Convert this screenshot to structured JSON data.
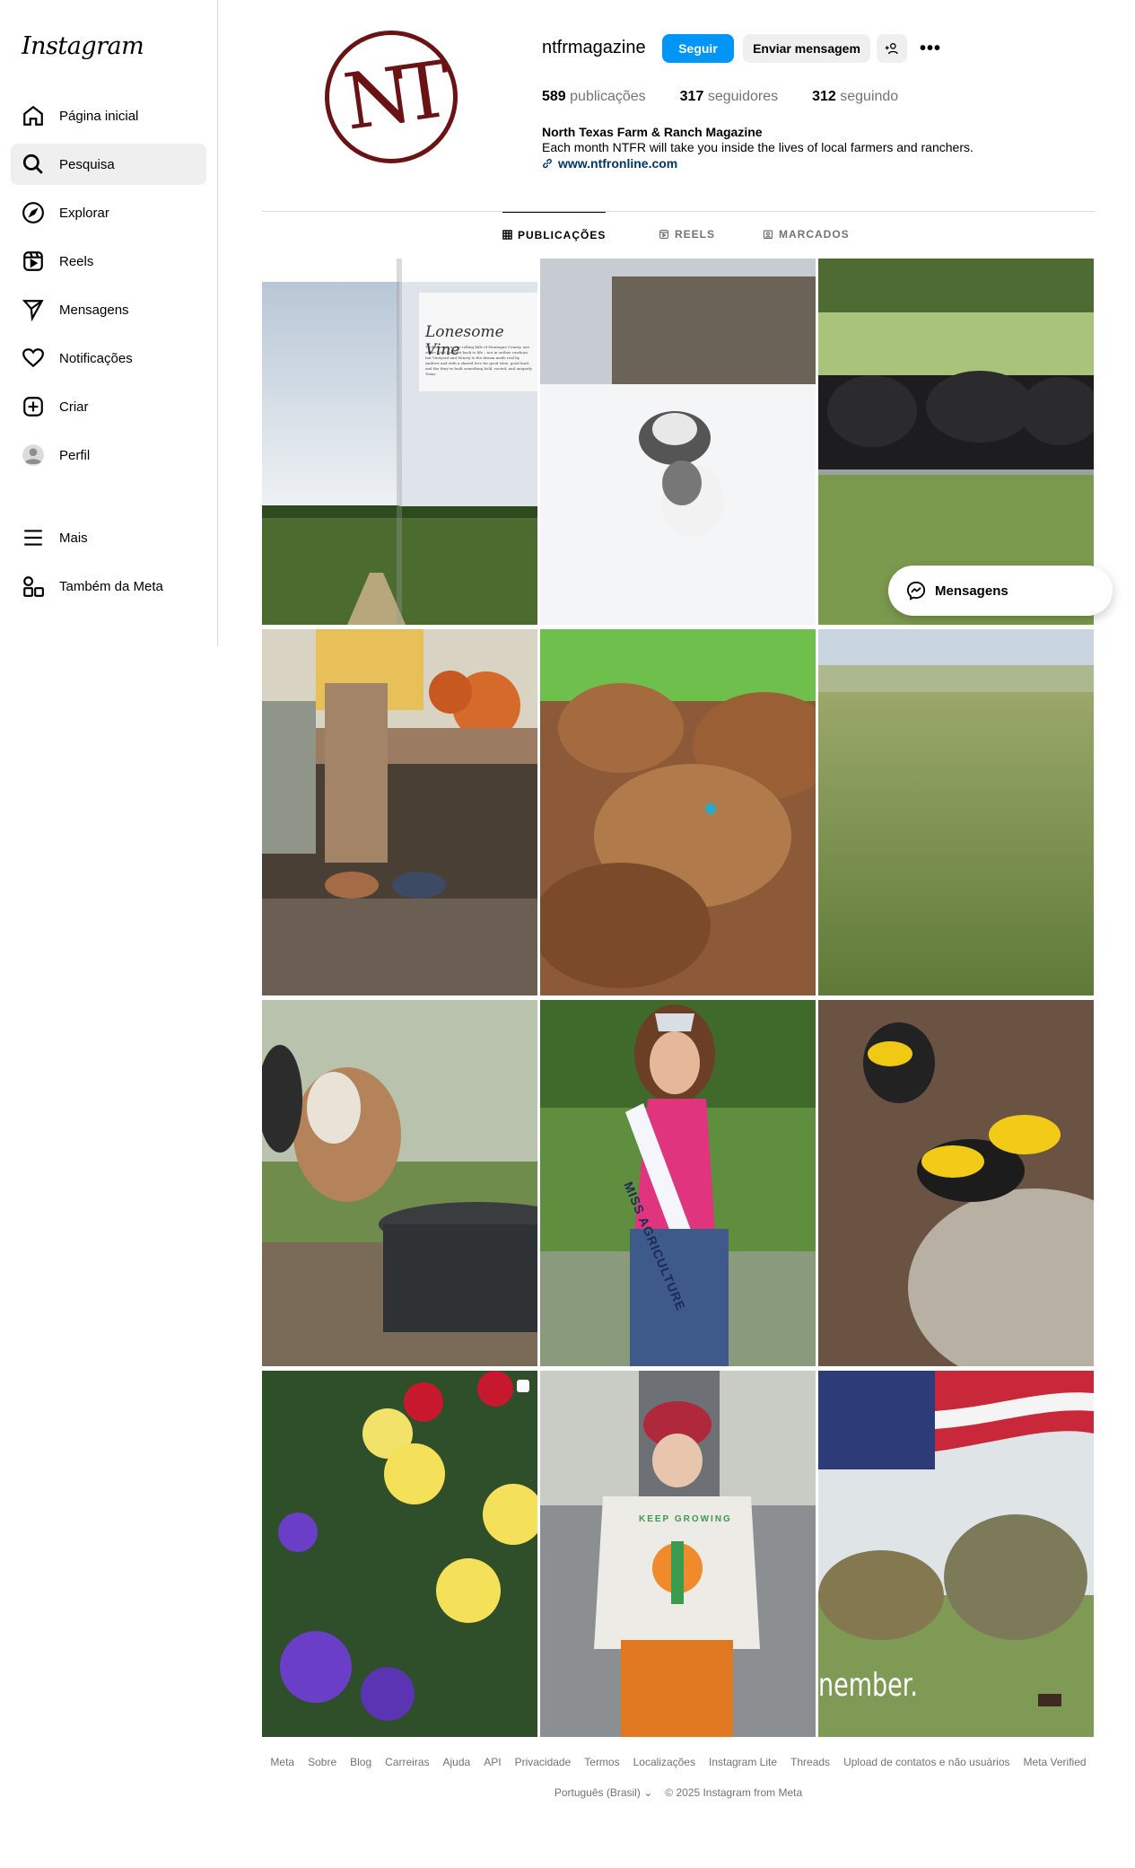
{
  "sidebar": {
    "logo_text": "Instagram",
    "items": [
      {
        "label": "Página inicial",
        "icon": "home-icon"
      },
      {
        "label": "Pesquisa",
        "icon": "search-icon"
      },
      {
        "label": "Explorar",
        "icon": "compass-icon"
      },
      {
        "label": "Reels",
        "icon": "reels-icon"
      },
      {
        "label": "Mensagens",
        "icon": "send-icon"
      },
      {
        "label": "Notificações",
        "icon": "heart-icon"
      },
      {
        "label": "Criar",
        "icon": "plus-square-icon"
      },
      {
        "label": "Perfil",
        "icon": "avatar-icon"
      }
    ],
    "more_label": "Mais",
    "meta_label": "Também da Meta"
  },
  "profile": {
    "avatar_text": "NT",
    "username": "ntfrmagazine",
    "follow_label": "Seguir",
    "message_label": "Enviar mensagem",
    "posts_count": "589",
    "posts_label": "publicações",
    "followers_count": "317",
    "followers_label": "seguidores",
    "following_count": "312",
    "following_label": "seguindo",
    "bio_name": "North Texas Farm & Ranch Magazine",
    "bio_text": "Each month NTFR will take you inside the lives of local farmers and ranchers.",
    "bio_link": "www.ntfronline.com"
  },
  "tabs": [
    {
      "label": "PUBLICAÇÕES",
      "icon": "grid-icon"
    },
    {
      "label": "REELS",
      "icon": "reels-icon"
    },
    {
      "label": "MARCADOS",
      "icon": "tagged-icon"
    }
  ],
  "post_texts": {
    "magazine_title": "Lonesome Vine",
    "magazine_body": "Tucked away in the rolling hills of Montague County, one of the West brought back to life – not in outlaw cowboys, but Vineyard and Winery is the dream made real by Andrew and with a shared love for good wine, good land, and the they've built something bold, rooted, and uniquely Texas.",
    "sash_text": "MISS AGRICULTURE",
    "shirt_text": "KEEP GROWING",
    "flag_caption": "nember."
  },
  "messages_float": {
    "label": "Mensagens"
  },
  "footer": {
    "links": [
      "Meta",
      "Sobre",
      "Blog",
      "Carreiras",
      "Ajuda",
      "API",
      "Privacidade",
      "Termos",
      "Localizações",
      "Instagram Lite",
      "Threads",
      "Upload de contatos e não usuários",
      "Meta Verified"
    ],
    "language": "Português (Brasil)",
    "copyright": "© 2025 Instagram from Meta"
  },
  "colors": {
    "accent": "#0095f6",
    "link": "#00376b",
    "brand_maroon": "#6b1314"
  }
}
